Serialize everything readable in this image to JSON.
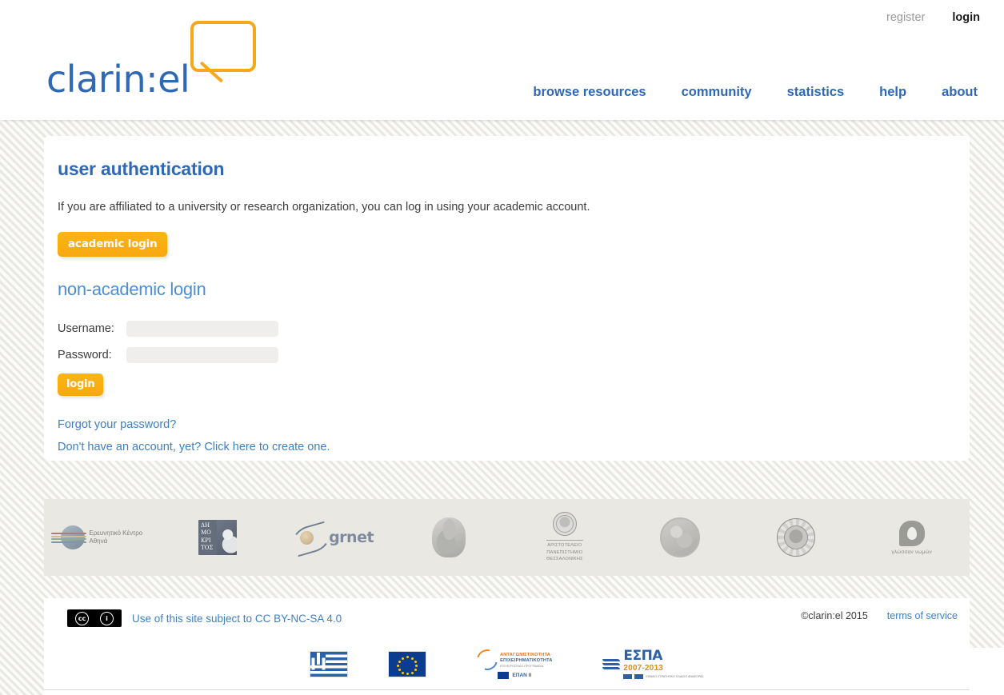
{
  "header": {
    "logo_text": "clarin:el",
    "top_links": [
      {
        "label": "register",
        "name": "register-link"
      },
      {
        "label": "login",
        "name": "login-link"
      }
    ],
    "nav": [
      {
        "label": "browse resources"
      },
      {
        "label": "community"
      },
      {
        "label": "statistics"
      },
      {
        "label": "help"
      },
      {
        "label": "about"
      }
    ]
  },
  "main": {
    "page_title": "user authentication",
    "intro_text": "If you are affiliated to a university or research organization, you can log in using your academic account.",
    "academic_login_label": "academic login",
    "section_title": "non-academic login",
    "form": {
      "username_label": "Username:",
      "username_value": "",
      "username_placeholder": "",
      "password_label": "Password:",
      "password_value": "",
      "password_placeholder": "",
      "submit_label": "login"
    },
    "links": [
      {
        "label": "Forgot your password?"
      },
      {
        "label": "Don't have an account, yet? Click here to create one."
      }
    ]
  },
  "partners": [
    {
      "name": "athena-research-centre",
      "line1": "Ερευνητικό Κέντρο",
      "line2": "Αθηνά"
    },
    {
      "name": "demokritos",
      "line1": "ΔΗ",
      "line2": "ΜΟ",
      "line3": "ΚΡΙ",
      "line4": "ΤΟΣ"
    },
    {
      "name": "grnet",
      "label": "grnet"
    },
    {
      "name": "national-kapodistrian-university-of-athens",
      "label": ""
    },
    {
      "name": "aristotle-university-of-thessaloniki",
      "line1": "ΑΡΙΣΤΟΤΕΛΕΙΟ",
      "line2": "ΠΑΝΕΠΙΣΤΗΜΙΟ",
      "line3": "ΘΕΣΣΑΛΟΝΙΚΗΣ"
    },
    {
      "name": "university-seal",
      "label": ""
    },
    {
      "name": "ionian-university",
      "label": ""
    },
    {
      "name": "glossan-nomon",
      "label": "γλώσσαν νωμών"
    }
  ],
  "footer": {
    "cc_license_text": "Use of this site subject to CC BY-NC-SA 4.0",
    "cc_badge_cc": "cc",
    "cc_badge_by": "i",
    "copyright": "©clarin:el 2015",
    "terms_label": "terms of service",
    "eu_logos": [
      {
        "name": "greek-flag",
        "label": ""
      },
      {
        "name": "eu-flag",
        "label": ""
      },
      {
        "name": "epan-logo",
        "line1": "ΑΝΤΑΓΩΝΙΣΤΙΚΟΤΗΤΑ",
        "line2": "ΕΠΙΧΕΙΡΗΜΑΤΙΚΟΤΗΤΑ",
        "line3": "ΕΠΙΧΕΙΡΗΣΙΑΚΟ ΠΡΟΓΡΑΜΜΑ",
        "badge": "ΕΠΑΝ ΙΙ"
      },
      {
        "name": "espa-logo",
        "title": "ΕΣΠΑ",
        "years": "2007-2013",
        "fine": "ΕΘΝΙΚΟ ΣΤΡΑΤΗΓΙΚΟ ΠΛΑΙΣΙΟ ΑΝΑΦΟΡΑΣ"
      }
    ]
  },
  "colors": {
    "brand_blue": "#2f68b5",
    "brand_yellow": "#f6a811",
    "link_blue": "#3f7fc4",
    "strip_gray": "#e9e8e3"
  }
}
